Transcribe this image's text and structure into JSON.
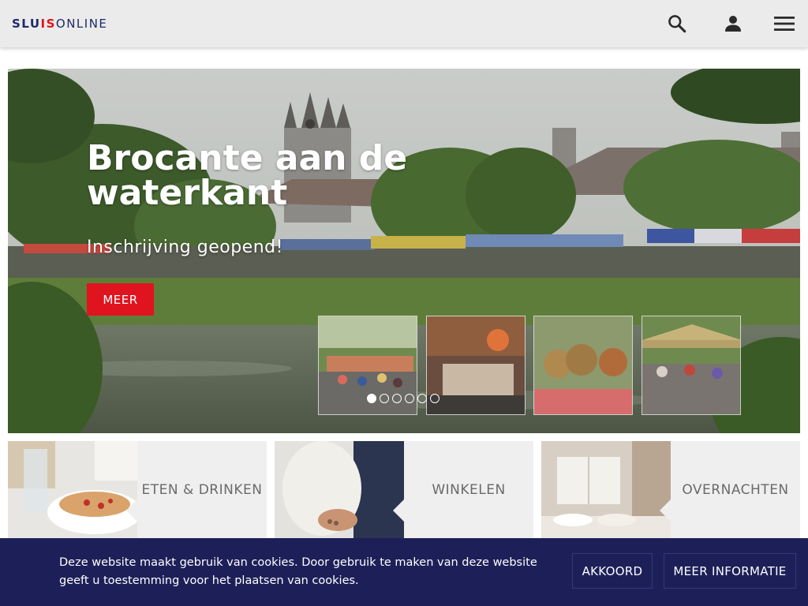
{
  "header": {
    "logo_part1": "SLU",
    "logo_part2": "IS",
    "logo_part3": "ONLINE",
    "icons": [
      "search-icon",
      "user-icon",
      "menu-icon"
    ]
  },
  "hero": {
    "title": "Brocante aan de waterkant",
    "subtitle": "Inschrijving geopend!",
    "button_label": "MEER",
    "slides_total": 6,
    "active_slide": 1
  },
  "tiles": [
    {
      "label": "ETEN & DRINKEN"
    },
    {
      "label": "WINKELEN"
    },
    {
      "label": "OVERNACHTEN"
    }
  ],
  "cookie": {
    "text": "Deze website maakt gebruik van cookies. Door gebruik te maken van deze website geeft u toestemming voor het plaatsen van cookies.",
    "accept_label": "AKKOORD",
    "info_label": "MEER INFORMATIE"
  },
  "colors": {
    "brand_red": "#e0141e",
    "brand_navy": "#1d2058",
    "header_bg": "#ebebeb"
  }
}
